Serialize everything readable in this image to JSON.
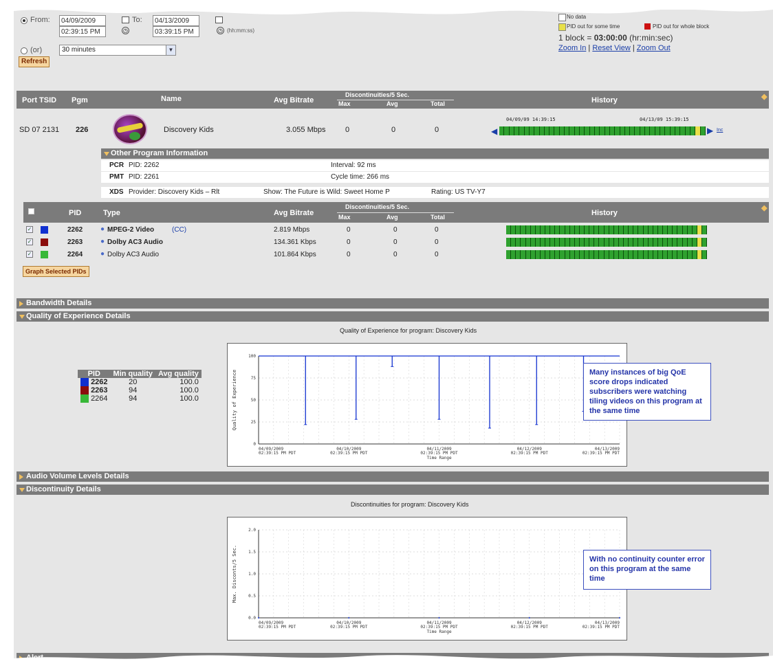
{
  "controls": {
    "from_label": "From:",
    "from_date": "04/09/2009",
    "from_time": "02:39:15 PM",
    "to_label": "To:",
    "to_date": "04/13/2009",
    "to_time": "03:39:15 PM",
    "time_hint": "(hh:mm:ss)",
    "or_label": "(or)",
    "duration": "30 minutes",
    "refresh_label": "Refresh"
  },
  "legend": {
    "no_data": "No data",
    "pid_out_some": "PID out for some time",
    "pid_out_whole": "PID out for whole block",
    "block_prefix": "1 block =",
    "block_value": "03:00:00",
    "block_suffix": "(hr:min:sec)",
    "zoom_in": "Zoom In",
    "reset_view": "Reset View",
    "zoom_out": "Zoom Out",
    "sep": "|"
  },
  "program_table": {
    "headers": {
      "port_tsid": "Port TSID",
      "pgm": "Pgm",
      "name": "Name",
      "avg_bitrate": "Avg Bitrate",
      "disc_group": "Discontinuities/5 Sec.",
      "max": "Max",
      "avg": "Avg",
      "total": "Total",
      "history": "History"
    },
    "row": {
      "port_tsid": "SD 07 2131",
      "pgm": "226",
      "name": "Discovery Kids",
      "avg_bitrate": "3.055 Mbps",
      "max": "0",
      "avg": "0",
      "total": "0",
      "history_start": "04/09/09 14:39:15",
      "history_end": "04/13/09 15:39:15",
      "more": "Inc"
    },
    "history_pattern": "gggggggggggggggggggggggggggggggggggggggyg"
  },
  "other_info": {
    "title": "Other Program Information",
    "pcr_label": "PCR",
    "pcr_value": "PID: 2262",
    "pcr_interval": "Interval: 92 ms",
    "pmt_label": "PMT",
    "pmt_value": "PID: 2261",
    "pmt_cycle": "Cycle time: 266 ms",
    "xds_label": "XDS",
    "xds_provider": "Provider: Discovery Kids – Rlt",
    "xds_show": "Show: The Future is Wild: Sweet Home P",
    "xds_rating": "Rating: US TV-Y7"
  },
  "pid_table": {
    "headers": {
      "pid": "PID",
      "type": "Type",
      "avg_bitrate": "Avg Bitrate",
      "disc_group": "Discontinuities/5 Sec.",
      "max": "Max",
      "avg": "Avg",
      "total": "Total",
      "history": "History"
    },
    "rows": [
      {
        "pid": "2262",
        "type": "MPEG-2 Video",
        "cc": "(CC)",
        "avg_bitrate": "2.819 Mbps",
        "max": "0",
        "avg": "0",
        "total": "0",
        "color": "#1030d0"
      },
      {
        "pid": "2263",
        "type": "Dolby AC3 Audio",
        "cc": "",
        "avg_bitrate": "134.361 Kbps",
        "max": "0",
        "avg": "0",
        "total": "0",
        "color": "#8b0d0d"
      },
      {
        "pid": "2264",
        "type": "Dolby AC3 Audio",
        "cc": "",
        "avg_bitrate": "101.864 Kbps",
        "max": "0",
        "avg": "0",
        "total": "0",
        "color": "#38b838"
      }
    ],
    "graph_button": "Graph Selected PIDs"
  },
  "sections": {
    "bandwidth": "Bandwidth Details",
    "qoe": "Quality of Experience Details",
    "audio": "Audio Volume Levels Details",
    "disc": "Discontinuity Details",
    "alert": "Alert"
  },
  "qoe": {
    "chart_title": "Quality of Experience for program: Discovery Kids",
    "table_headers": {
      "pid": "PID",
      "min": "Min quality",
      "avg": "Avg quality"
    },
    "table_rows": [
      {
        "pid": "2262",
        "min": "20",
        "avg": "100.0",
        "color": "#1030d0"
      },
      {
        "pid": "2263",
        "min": "94",
        "avg": "100.0",
        "color": "#8b0d0d"
      },
      {
        "pid": "2264",
        "min": "94",
        "avg": "100.0",
        "color": "#38b838"
      }
    ],
    "callout": "Many instances of big QoE score drops indicated subscribers were watching tiling videos on this program at the same time"
  },
  "disc": {
    "chart_title": "Discontinuities for program: Discovery Kids",
    "callout": "With no continuity counter error on this program at the same time"
  },
  "chart_data": [
    {
      "type": "line",
      "title": "",
      "xlabel": "Time Range",
      "ylabel": "Quality of Experience",
      "ylim": [
        0,
        100
      ],
      "yticks": [
        "0",
        "25",
        "50",
        "75",
        "100"
      ],
      "x_ticks": [
        [
          "04/09/2009",
          "02:39:15 PM PDT"
        ],
        [
          "04/10/2009",
          "02:39:15 PM PDT"
        ],
        [
          "04/11/2009",
          "02:39:15 PM PDT"
        ],
        [
          "04/12/2009",
          "02:39:15 PM PDT"
        ],
        [
          "04/13/2009",
          "02:39:15 PM PDT"
        ]
      ],
      "baseline": 100,
      "drops": [
        {
          "x": 0.13,
          "value": 22
        },
        {
          "x": 0.27,
          "value": 28
        },
        {
          "x": 0.37,
          "value": 88
        },
        {
          "x": 0.5,
          "value": 28
        },
        {
          "x": 0.64,
          "value": 18
        },
        {
          "x": 0.77,
          "value": 22
        },
        {
          "x": 0.9,
          "value": 37
        }
      ]
    },
    {
      "type": "line",
      "title": "",
      "xlabel": "Time Range",
      "ylabel": "Max. Disconts/5 Sec.",
      "ylim": [
        0,
        2
      ],
      "yticks": [
        "0.0",
        "0.5",
        "1.0",
        "1.5",
        "2.0"
      ],
      "x_ticks": [
        [
          "04/09/2009",
          "02:39:15 PM PDT"
        ],
        [
          "04/10/2009",
          "02:39:15 PM PDT"
        ],
        [
          "04/11/2009",
          "02:39:15 PM PDT"
        ],
        [
          "04/12/2009",
          "02:39:15 PM PDT"
        ],
        [
          "04/13/2009",
          "02:39:15 PM PDT"
        ]
      ],
      "values": [
        0,
        0,
        0,
        0,
        0
      ]
    }
  ]
}
